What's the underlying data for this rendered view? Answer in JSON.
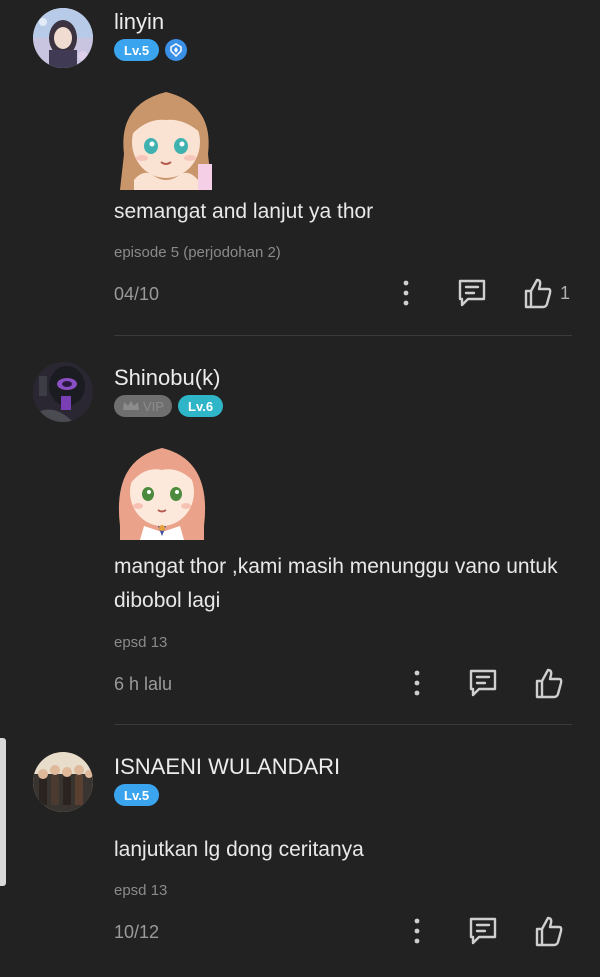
{
  "comments": [
    {
      "username": "linyin",
      "level": "Lv.5",
      "text": "semangat and lanjut ya thor",
      "episode": "episode 5 (perjodohan 2)",
      "date": "04/10",
      "likes": "1"
    },
    {
      "username": "Shinobu(k)",
      "vip": "VIP",
      "level": "Lv.6",
      "text": "mangat thor ,kami masih menunggu vano untuk dibobol lagi",
      "episode": "epsd 13",
      "date": "6 h lalu"
    },
    {
      "username": "ISNAENI WULANDARI",
      "level": "Lv.5",
      "text": "lanjutkan lg dong ceritanya",
      "episode": "epsd 13",
      "date": "10/12"
    }
  ],
  "icons": {
    "more": "more-vertical-icon",
    "reply": "reply-comment-icon",
    "like": "thumbs-up-icon",
    "badge": "shield-badge-icon"
  },
  "colors": {
    "background": "#222222",
    "level_blue": "#3aa5ee",
    "level_teal": "#2fb5c8"
  }
}
